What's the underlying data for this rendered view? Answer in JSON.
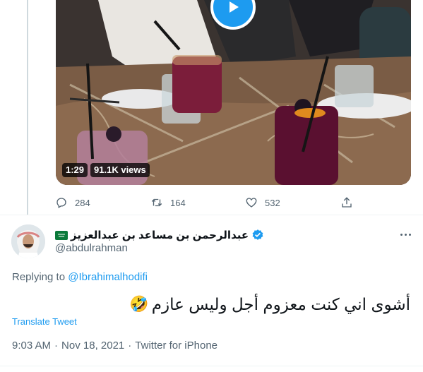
{
  "previous_tweet": {
    "video_duration": "1:29",
    "video_views": "91.1K views",
    "replies": "284",
    "retweets": "164",
    "likes": "532"
  },
  "tweet": {
    "display_name": "عبدالرحمن بن مساعد بن عبدالعزيز",
    "handle": "@abdulrahman",
    "replying_to_prefix": "Replying to",
    "replying_to_handle": "@Ibrahimalhodifi",
    "text": "أشوى اني كنت معزوم أجل وليس عازم",
    "emoji": "🤣",
    "translate_label": "Translate Tweet",
    "time": "9:03 AM",
    "date": "Nov 18, 2021",
    "separator": "·",
    "source": "Twitter for iPhone"
  },
  "colors": {
    "accent": "#1d9bf0",
    "secondary_text": "#536471",
    "verified": "#1d9bf0"
  },
  "icons": [
    "play-icon",
    "reply-icon",
    "retweet-icon",
    "like-icon",
    "share-icon",
    "saudi-flag-icon",
    "verified-badge-icon",
    "more-icon",
    "rofl-emoji"
  ]
}
